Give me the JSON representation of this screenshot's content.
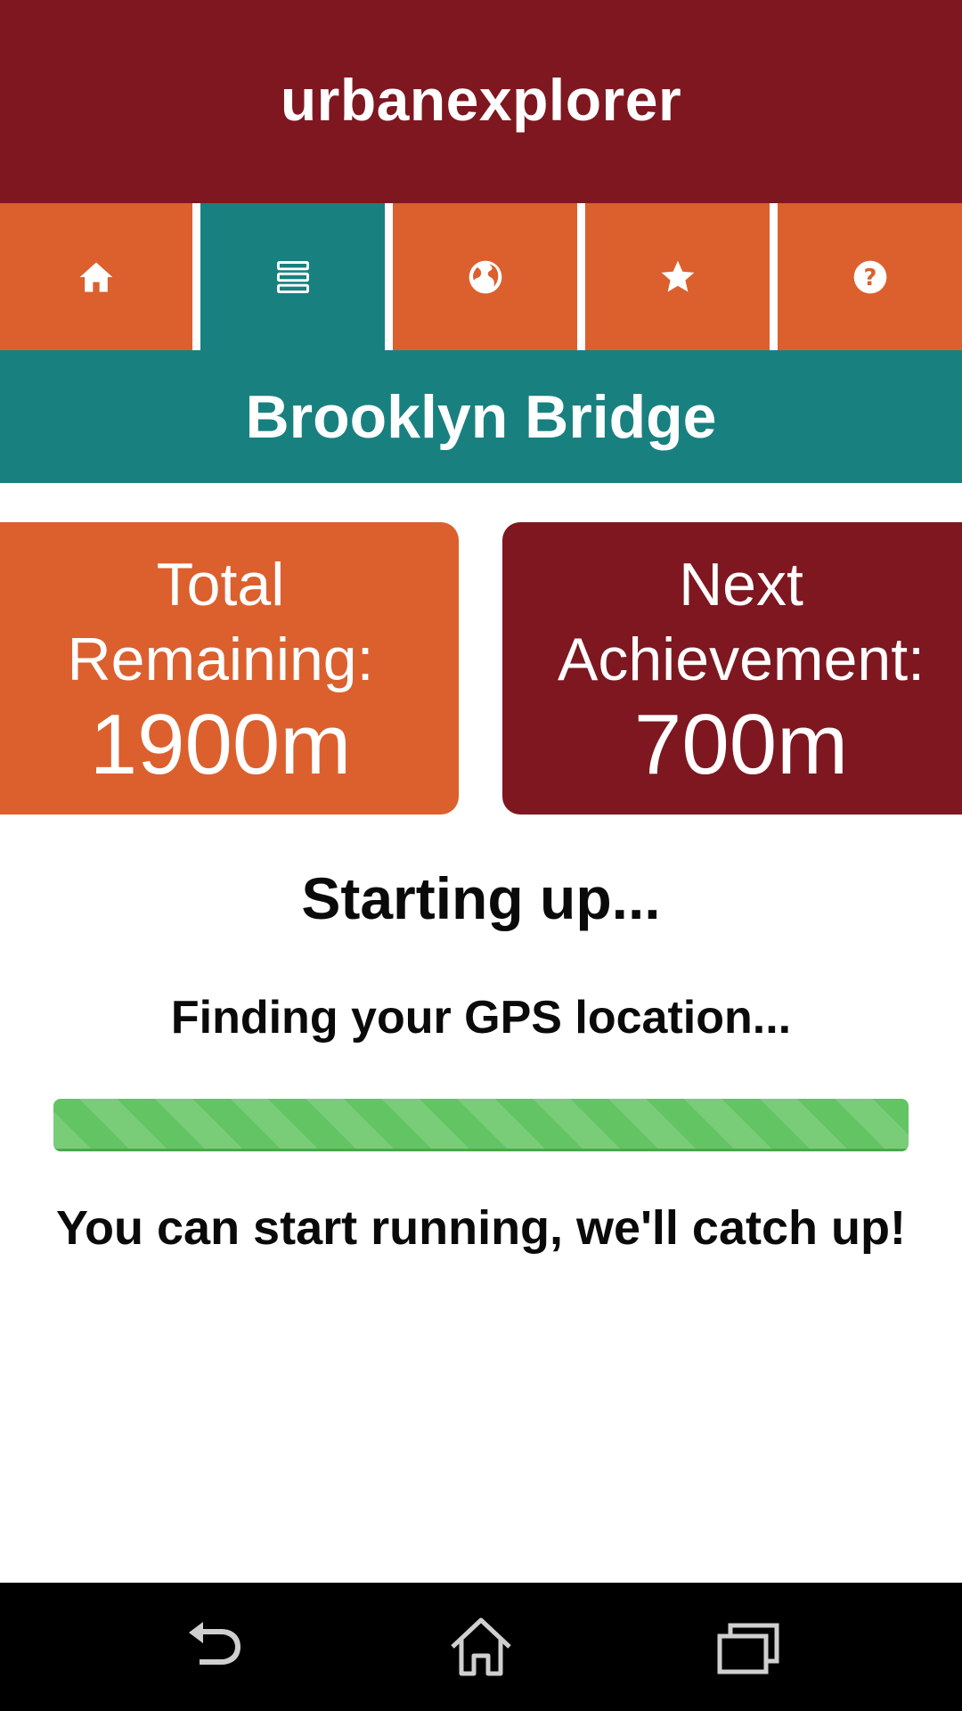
{
  "app": {
    "title": "urbanexplorer",
    "colors": {
      "header": "#7e1720",
      "tab": "#db602e",
      "tab_active": "#198080",
      "progress": "#62c462"
    }
  },
  "tabs": [
    {
      "icon": "home-icon",
      "active": false
    },
    {
      "icon": "list-icon",
      "active": true
    },
    {
      "icon": "globe-icon",
      "active": false
    },
    {
      "icon": "star-icon",
      "active": false
    },
    {
      "icon": "help-icon",
      "active": false
    }
  ],
  "place": {
    "name": "Brooklyn Bridge"
  },
  "stats": {
    "total": {
      "label_line1": "Total",
      "label_line2": "Remaining:",
      "value": "1900m"
    },
    "next": {
      "label_line1": "Next",
      "label_line2": "Achievement:",
      "value": "700m"
    }
  },
  "status": {
    "title": "Starting up...",
    "subtitle": "Finding your GPS location...",
    "progress_percent": 100,
    "message": "You can start running, we'll catch up!"
  },
  "system_nav": {
    "buttons": [
      "back-icon",
      "home-icon",
      "recents-icon"
    ]
  }
}
